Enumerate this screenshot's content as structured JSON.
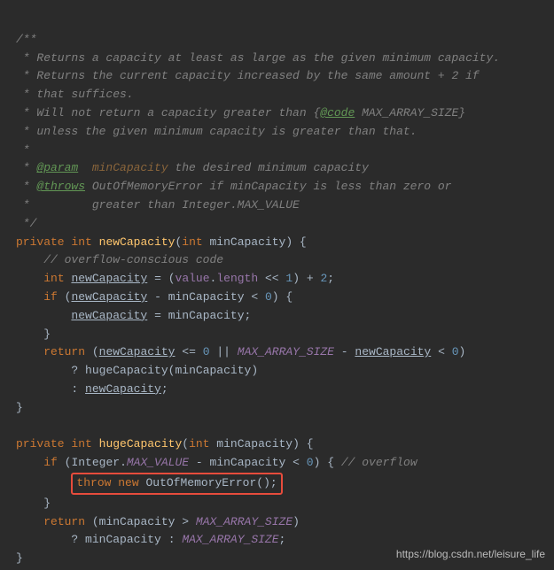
{
  "doc": {
    "l1": "/**",
    "l2": " * Returns a capacity at least as large as the given minimum capacity.",
    "l3": " * Returns the current capacity increased by the same amount + 2 if",
    "l4": " * that suffices.",
    "l5a": " * Will not return a capacity greater than {",
    "l5tag": "@code",
    "l5b": " MAX_ARRAY_SIZE}",
    "l6": " * unless the given minimum capacity is greater than that.",
    "l7": " *",
    "l8a": " * ",
    "l8tag": "@param",
    "l8name": "  minCapacity",
    "l8b": " the desired minimum capacity",
    "l9a": " * ",
    "l9tag": "@throws",
    "l9name": " OutOfMemoryError",
    "l9b": " if minCapacity is less than zero or",
    "l10": " *         greater than Integer.MAX_VALUE",
    "l11": " */"
  },
  "kw": {
    "private": "private",
    "int": "int",
    "if": "if",
    "return": "return",
    "throw": "throw",
    "new": "new"
  },
  "m1": {
    "name": "newCapacity",
    "param": "minCapacity",
    "comment": "// overflow-conscious code",
    "var_newCapacity": "newCapacity",
    "value": "value",
    "length": "length",
    "shift": "<<",
    "one": "1",
    "plus": "+",
    "two": "2",
    "minus": "-",
    "lt": "<",
    "zero": "0",
    "assign": "=",
    "lte": "<=",
    "oror": "||",
    "max_arr": "MAX_ARRAY_SIZE",
    "q": "?",
    "colon": ":",
    "huge": "hugeCapacity"
  },
  "m2": {
    "name": "hugeCapacity",
    "param": "minCapacity",
    "integer": "Integer",
    "max_value": "MAX_VALUE",
    "minus": "-",
    "lt": "<",
    "zero": "0",
    "comment": "// overflow",
    "oome": "OutOfMemoryError",
    "gt": ">",
    "max_arr": "MAX_ARRAY_SIZE",
    "q": "?",
    "colon": ":"
  },
  "watermark": "https://blog.csdn.net/leisure_life"
}
